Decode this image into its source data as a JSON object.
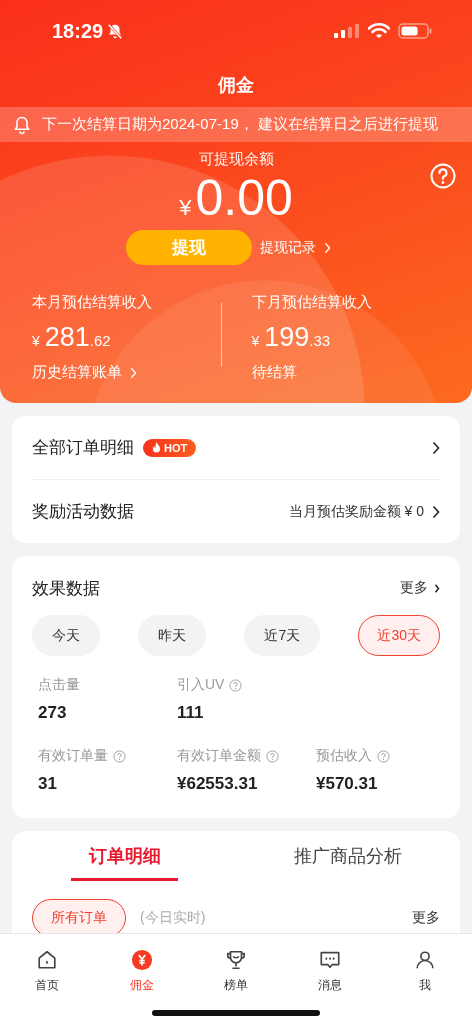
{
  "status_bar": {
    "time": "18:29"
  },
  "header": {
    "title": "佣金"
  },
  "notice": {
    "text": "下一次结算日期为2024-07-19， 建议在结算日之后进行提现"
  },
  "balance": {
    "label": "可提现余额",
    "currency": "¥",
    "amount": "0.00",
    "withdraw_button": "提现",
    "history_link": "提现记录"
  },
  "estimates": [
    {
      "label": "本月预估结算收入",
      "currency": "¥",
      "integer": "281",
      "decimal": ".62",
      "link": "历史结算账单",
      "chevron": true
    },
    {
      "label": "下月预估结算收入",
      "currency": "¥",
      "integer": "199",
      "decimal": ".33",
      "link": "待结算",
      "chevron": false
    }
  ],
  "menu": [
    {
      "label": "全部订单明细",
      "badge": "HOT"
    },
    {
      "label": "奖励活动数据",
      "detail": "当月预估奖励金额 ¥ 0"
    }
  ],
  "effect": {
    "title": "效果数据",
    "more": "更多",
    "periods": [
      {
        "label": "今天",
        "selected": false
      },
      {
        "label": "昨天",
        "selected": false
      },
      {
        "label": "近7天",
        "selected": false
      },
      {
        "label": "近30天",
        "selected": true
      }
    ],
    "metric_rows": [
      [
        {
          "label": "点击量",
          "value": "273",
          "help": false
        },
        {
          "label": "引入UV",
          "value": "111",
          "help": true
        }
      ],
      [
        {
          "label": "有效订单量",
          "value": "31",
          "help": true
        },
        {
          "label": "有效订单金额",
          "value": "¥62553.31",
          "help": true
        },
        {
          "label": "预估收入",
          "value": "¥570.31",
          "help": true
        }
      ]
    ]
  },
  "orders": {
    "tabs": [
      {
        "label": "订单明细",
        "selected": true
      },
      {
        "label": "推广商品分析",
        "selected": false
      }
    ],
    "filter": "所有订单",
    "note": "(今日实时)",
    "more": "更多"
  },
  "tab_bar": [
    {
      "label": "首页",
      "selected": false
    },
    {
      "label": "佣金",
      "selected": true
    },
    {
      "label": "榜单",
      "selected": false
    },
    {
      "label": "消息",
      "selected": false
    },
    {
      "label": "我",
      "selected": false
    }
  ]
}
